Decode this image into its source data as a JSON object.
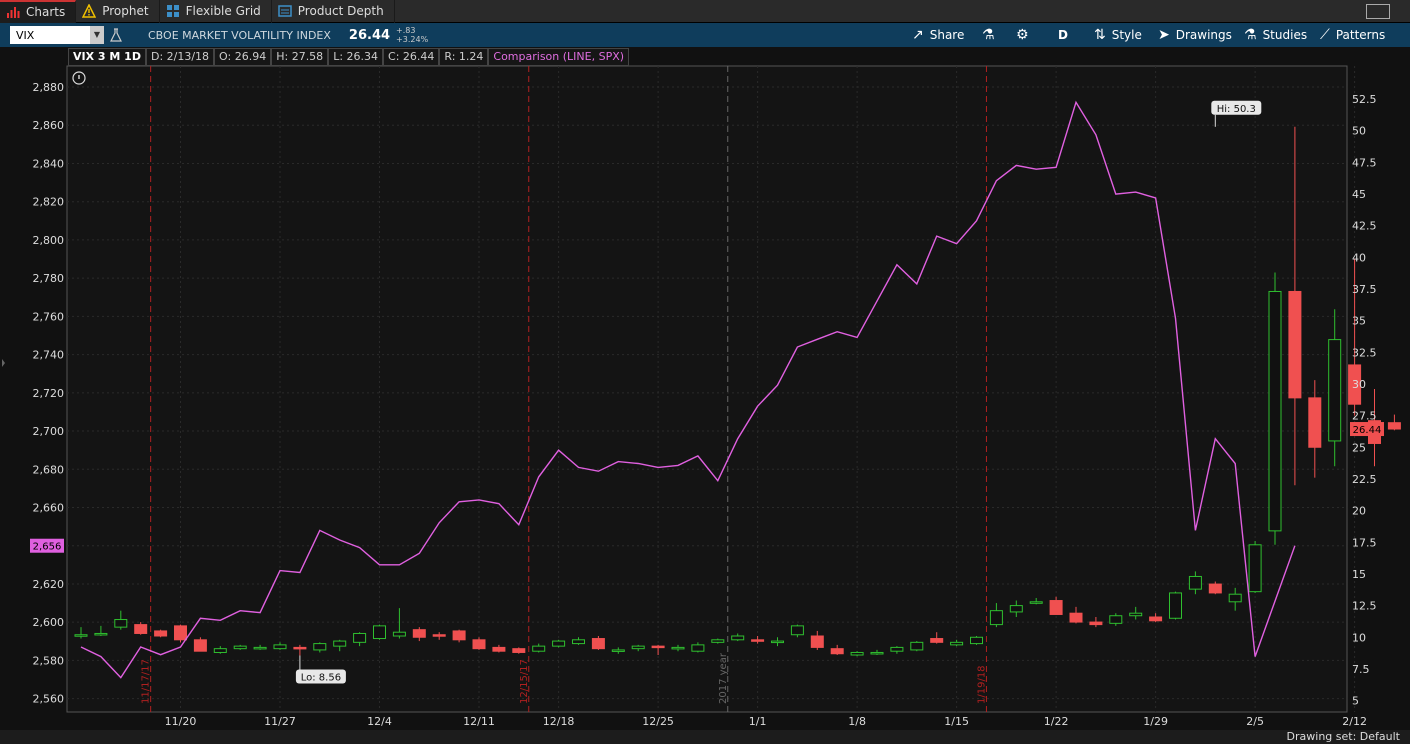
{
  "tabs": [
    {
      "label": "Charts",
      "icon": "bar-chart-icon",
      "active": true
    },
    {
      "label": "Prophet",
      "icon": "warning-triangle-icon",
      "active": false
    },
    {
      "label": "Flexible Grid",
      "icon": "grid-icon",
      "active": false
    },
    {
      "label": "Product Depth",
      "icon": "depth-icon",
      "active": false
    }
  ],
  "toolbar": {
    "symbol": "VIX",
    "symbol_name": "CBOE MARKET VOLATILITY INDEX",
    "last": "26.44",
    "change": "+.83",
    "change_pct": "+3.24%",
    "share_label": "Share",
    "aggregation": "D",
    "style_label": "Style",
    "drawings_label": "Drawings",
    "studies_label": "Studies",
    "patterns_label": "Patterns"
  },
  "infobar": {
    "title": "VIX 3 M 1D",
    "date": "D: 2/13/18",
    "open": "O: 26.94",
    "high": "H: 27.58",
    "low": "L: 26.34",
    "close": "C: 26.44",
    "range": "R: 1.24",
    "comparison": "Comparison (LINE, SPX)"
  },
  "status": {
    "drawing_set": "Drawing set: Default"
  },
  "chart_data": {
    "type": "candlestick",
    "x_tick_labels": [
      "11/20",
      "11/27",
      "12/4",
      "12/11",
      "12/18",
      "12/25",
      "1/1",
      "1/8",
      "1/15",
      "1/22",
      "1/29",
      "2/5",
      "2/12"
    ],
    "left_axis": {
      "ylim": [
        2553,
        2891
      ],
      "ticks": [
        "2,560",
        "2,580",
        "2,600",
        "2,620",
        "2,640",
        "2,660",
        "2,680",
        "2,700",
        "2,720",
        "2,740",
        "2,760",
        "2,780",
        "2,800",
        "2,820",
        "2,840",
        "2,860",
        "2,880"
      ],
      "current_label": "2,656"
    },
    "right_axis": {
      "ylim": [
        4.1,
        55.1
      ],
      "ticks": [
        "5",
        "7.5",
        "10",
        "12.5",
        "15",
        "17.5",
        "20",
        "22.5",
        "25",
        "27.5",
        "30",
        "32.5",
        "35",
        "37.5",
        "40",
        "42.5",
        "45",
        "47.5",
        "50",
        "52.5"
      ],
      "current_label": "26.44"
    },
    "markers": [
      {
        "text": "Hi: 50.3",
        "index": 57,
        "value": 50.3
      },
      {
        "text": "Lo: 8.56",
        "index": 11,
        "value": 8.56
      }
    ],
    "vertical_markers": [
      {
        "index": 4,
        "label": "11/17/17",
        "style": "red"
      },
      {
        "index": 23,
        "label": "12/15/17",
        "style": "red"
      },
      {
        "index": 33,
        "label": "2017 year",
        "style": "gray"
      },
      {
        "index": 46,
        "label": "1/19/18",
        "style": "red"
      }
    ],
    "x_tick_index": [
      5,
      10,
      15,
      20,
      24,
      29,
      34,
      39,
      44,
      49,
      54,
      59,
      64
    ],
    "series": [
      {
        "name": "VIX",
        "type": "candlestick",
        "ohlc": [
          [
            10.2,
            10.8,
            9.9,
            10.2
          ],
          [
            10.2,
            10.9,
            10.1,
            10.3
          ],
          [
            10.8,
            12.1,
            10.6,
            11.4
          ],
          [
            11.0,
            11.2,
            10.2,
            10.3
          ],
          [
            10.5,
            10.6,
            10.0,
            10.1
          ],
          [
            10.9,
            11.0,
            9.6,
            9.8
          ],
          [
            9.8,
            10.0,
            8.9,
            8.9
          ],
          [
            8.8,
            9.3,
            8.7,
            9.1
          ],
          [
            9.1,
            9.4,
            9.0,
            9.3
          ],
          [
            9.2,
            9.4,
            9.0,
            9.2
          ],
          [
            9.1,
            9.6,
            9.0,
            9.4
          ],
          [
            9.2,
            9.4,
            8.56,
            9.1
          ],
          [
            9.0,
            9.6,
            8.8,
            9.5
          ],
          [
            9.3,
            9.8,
            8.9,
            9.7
          ],
          [
            9.6,
            10.4,
            9.3,
            10.3
          ],
          [
            9.9,
            11.0,
            9.8,
            10.9
          ],
          [
            10.1,
            12.3,
            9.9,
            10.4
          ],
          [
            10.6,
            10.8,
            9.7,
            10.0
          ],
          [
            10.2,
            10.4,
            9.8,
            10.1
          ],
          [
            10.5,
            10.6,
            9.6,
            9.8
          ],
          [
            9.8,
            10.0,
            9.0,
            9.1
          ],
          [
            9.2,
            9.4,
            8.8,
            8.9
          ],
          [
            9.1,
            9.2,
            8.7,
            8.8
          ],
          [
            8.9,
            9.5,
            8.8,
            9.3
          ],
          [
            9.3,
            9.8,
            9.2,
            9.7
          ],
          [
            9.5,
            10.0,
            9.4,
            9.8
          ],
          [
            9.9,
            10.1,
            9.0,
            9.1
          ],
          [
            8.9,
            9.2,
            8.7,
            9.0
          ],
          [
            9.1,
            9.4,
            8.9,
            9.3
          ],
          [
            9.3,
            9.4,
            8.6,
            9.2
          ],
          [
            9.2,
            9.4,
            8.9,
            9.2
          ],
          [
            8.9,
            9.6,
            8.8,
            9.4
          ],
          [
            9.6,
            9.9,
            9.5,
            9.8
          ],
          [
            9.8,
            10.3,
            9.7,
            10.1
          ],
          [
            9.8,
            10.1,
            9.5,
            9.7
          ],
          [
            9.6,
            10.0,
            9.3,
            9.7
          ],
          [
            10.2,
            11.0,
            10.0,
            10.9
          ],
          [
            10.1,
            10.5,
            9.0,
            9.2
          ],
          [
            9.1,
            9.4,
            8.6,
            8.7
          ],
          [
            8.6,
            8.9,
            8.5,
            8.8
          ],
          [
            8.7,
            9.0,
            8.6,
            8.8
          ],
          [
            8.9,
            9.3,
            8.7,
            9.2
          ],
          [
            9.0,
            9.7,
            8.9,
            9.6
          ],
          [
            9.9,
            10.4,
            9.5,
            9.6
          ],
          [
            9.4,
            9.8,
            9.3,
            9.6
          ],
          [
            9.5,
            10.1,
            9.4,
            10.0
          ],
          [
            11.0,
            12.7,
            10.8,
            12.1
          ],
          [
            12.0,
            12.9,
            11.6,
            12.5
          ],
          [
            12.7,
            13.1,
            12.6,
            12.8
          ],
          [
            12.9,
            13.2,
            11.8,
            11.8
          ],
          [
            11.9,
            12.4,
            11.1,
            11.2
          ],
          [
            11.2,
            11.6,
            10.8,
            11.0
          ],
          [
            11.1,
            11.9,
            10.9,
            11.7
          ],
          [
            11.7,
            12.4,
            11.4,
            11.9
          ],
          [
            11.6,
            11.9,
            11.2,
            11.3
          ],
          [
            11.5,
            13.6,
            11.4,
            13.5
          ],
          [
            13.8,
            15.2,
            13.4,
            14.8
          ],
          [
            14.2,
            14.4,
            13.4,
            13.5
          ],
          [
            12.8,
            13.9,
            12.1,
            13.4
          ],
          [
            13.6,
            17.6,
            13.5,
            17.3
          ],
          [
            18.4,
            38.8,
            17.3,
            37.3
          ],
          [
            37.3,
            50.3,
            22.0,
            28.9
          ],
          [
            28.9,
            30.3,
            22.6,
            25.0
          ],
          [
            25.5,
            35.9,
            23.5,
            33.5
          ],
          [
            31.5,
            39.9,
            27.5,
            28.4
          ],
          [
            27.1,
            29.6,
            23.5,
            25.3
          ],
          [
            26.94,
            27.58,
            26.34,
            26.44
          ]
        ]
      },
      {
        "name": "SPX",
        "type": "line",
        "values": [
          2587,
          2582,
          2571,
          2587,
          2583,
          2587,
          2602,
          2601,
          2606,
          2605,
          2627,
          2626,
          2648,
          2643,
          2639,
          2630,
          2630,
          2636,
          2652,
          2663,
          2664,
          2662,
          2651,
          2676,
          2690,
          2681,
          2679,
          2684,
          2683,
          2681,
          2682,
          2687,
          2674,
          2696,
          2713,
          2724,
          2744,
          2748,
          2752,
          2749,
          2768,
          2787,
          2777,
          2802,
          2798,
          2810,
          2831,
          2839,
          2837,
          2838,
          2872,
          2855,
          2824,
          2825,
          2822,
          2759,
          2648,
          2696,
          2683,
          2582,
          2611,
          2640
        ]
      }
    ]
  }
}
